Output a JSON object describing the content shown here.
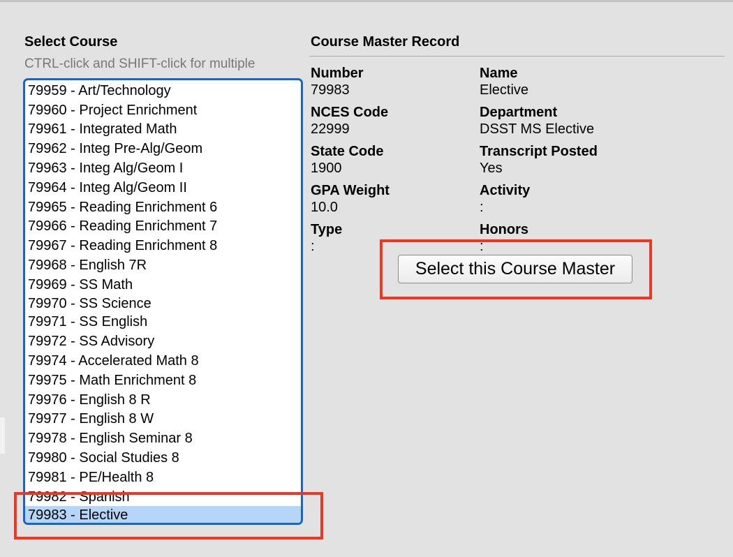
{
  "select_course": {
    "heading": "Select Course",
    "hint": "CTRL-click and SHIFT-click for multiple",
    "courses": [
      "79959 - Art/Technology",
      "79960 - Project Enrichment",
      "79961 - Integrated Math",
      "79962 - Integ Pre-Alg/Geom",
      "79963 - Integ Alg/Geom I",
      "79964 - Integ Alg/Geom II",
      "79965 - Reading Enrichment 6",
      "79966 - Reading Enrichment 7",
      "79967 - Reading Enrichment 8",
      "79968 - English 7R",
      "79969 - SS Math",
      "79970 - SS Science",
      "79971 - SS English",
      "79972 - SS Advisory",
      "79974 - Accelerated Math 8",
      "79975 - Math Enrichment 8",
      "79976 - English 8 R",
      "79977 - English 8 W",
      "79978 - English Seminar 8",
      "79980 - Social Studies 8",
      "79981 - PE/Health 8",
      "79982 - Spanish",
      "79983 - Elective"
    ],
    "selected": "79983 - Elective"
  },
  "record": {
    "heading": "Course Master Record",
    "fields": [
      {
        "label": "Number",
        "value": "79983"
      },
      {
        "label": "Name",
        "value": "Elective"
      },
      {
        "label": "NCES Code",
        "value": "22999"
      },
      {
        "label": "Department",
        "value": "DSST MS Elective"
      },
      {
        "label": "State Code",
        "value": "1900"
      },
      {
        "label": "Transcript Posted",
        "value": "Yes"
      },
      {
        "label": "GPA Weight",
        "value": "10.0"
      },
      {
        "label": "Activity",
        "value": ":"
      },
      {
        "label": "Type",
        "value": ":"
      },
      {
        "label": "Honors",
        "value": ":"
      }
    ],
    "select_button": "Select this Course Master"
  },
  "colors": {
    "listbox_border": "#1c63c9",
    "selected_option": "#b6d6f9",
    "annotation_box": "#ee3622"
  }
}
